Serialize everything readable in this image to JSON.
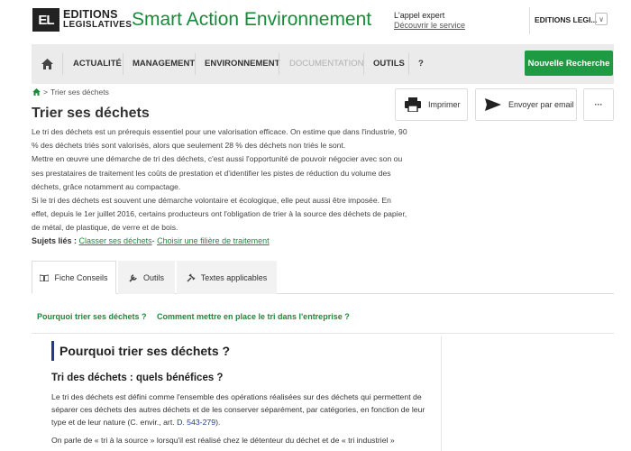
{
  "header": {
    "logo_mark": "EL",
    "logo_line1": "EDITIONS",
    "logo_line2": "LEGISLATIVES",
    "app_title": "Smart Action Environnement",
    "expert_label": "L'appel expert",
    "expert_link": "Découvrir le service",
    "account_label": "EDITIONS LEGI...",
    "account_chevron": "∨"
  },
  "nav": {
    "items": [
      {
        "label": "ACTUALITÉ"
      },
      {
        "label": "MANAGEMENT"
      },
      {
        "label": "ENVIRONNEMENT"
      },
      {
        "label": "DOCUMENTATION"
      },
      {
        "label": "OUTILS"
      },
      {
        "label": "?"
      }
    ],
    "cta_label": "Nouvelle Recherche"
  },
  "breadcrumb": {
    "separator": ">",
    "current": "Trier ses déchets"
  },
  "page": {
    "title": "Trier ses déchets",
    "print_label": "Imprimer",
    "email_label": "Envoyer par email",
    "more_label": "···",
    "paragraphs": [
      "Le tri des déchets est un prérequis essentiel pour une valorisation efficace. On estime que dans l'industrie, 90 % des déchets triés sont valorisés, alors que seulement 28 % des déchets non triés le sont.",
      "Mettre en œuvre une démarche de tri des déchets, c'est aussi l'opportunité de pouvoir négocier avec son ou ses prestataires de traitement les coûts de prestation et d'identifier les pistes de réduction du volume des déchets, grâce notamment au compactage.",
      "Si le tri des déchets est souvent une démarche volontaire et écologique, elle peut aussi être imposée. En effet, depuis le 1er juillet 2016, certains producteurs ont l'obligation de trier à la source des déchets de papier, de métal, de plastique, de verre et de bois."
    ],
    "related_label": "Sujets liés :",
    "related_links": [
      "Classer ses déchets",
      "Choisir une filière de traitement"
    ],
    "related_sep": "-"
  },
  "tabs": [
    {
      "label": "Fiche Conseils"
    },
    {
      "label": "Outils"
    },
    {
      "label": "Textes applicables"
    }
  ],
  "anchors": [
    "Pourquoi trier ses déchets ?",
    "Comment mettre en place le tri dans l'entreprise ?"
  ],
  "content": {
    "section_title": "Pourquoi trier ses déchets ?",
    "sub_title": "Tri des déchets : quels bénéfices ?",
    "para1": "Le tri des déchets est défini comme l'ensemble des opérations réalisées sur des déchets qui permettent de séparer ces déchets des autres déchets et de les conserver séparément, par catégories, en fonction de leur type et de leur nature (C. envir., art. ",
    "para1_ref": "D. 543-279",
    "para1_end": ").",
    "para2": "On parle de « tri à la source » lorsqu'il est réalisé chez le détenteur du déchet et de « tri industriel »"
  },
  "colors": {
    "brand_green": "#1a8a3a",
    "cta_green": "#1d9a42",
    "accent_blue": "#1f3a8f",
    "nav_bg": "#ebebeb"
  }
}
